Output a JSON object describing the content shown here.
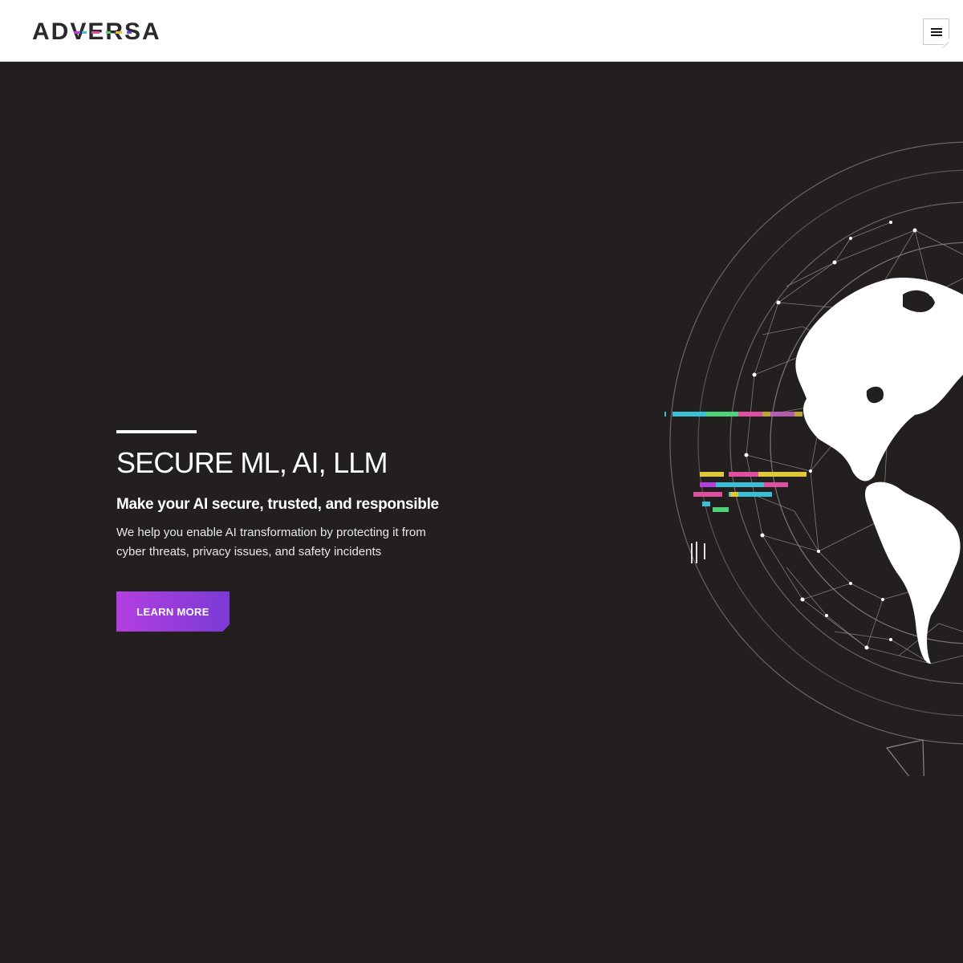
{
  "header": {
    "logo_text": "ADVERSA",
    "menu_icon": "hamburger-menu-icon"
  },
  "hero": {
    "headline": "SECURE ML, AI, LLM",
    "subheadline": "Make your AI secure, trusted, and responsible",
    "description": "We help you enable AI transformation by protecting it from cyber threats, privacy issues, and safety incidents",
    "cta_label": "LEARN MORE"
  },
  "colors": {
    "page_background": "#231f1f",
    "header_background": "#ffffff",
    "cta_gradient_start": "#b43fe0",
    "cta_gradient_end": "#7a3ad6",
    "text": "#ffffff"
  },
  "icons": {
    "menu": "hamburger-menu-icon",
    "hero_art": "globe-network-icon"
  }
}
